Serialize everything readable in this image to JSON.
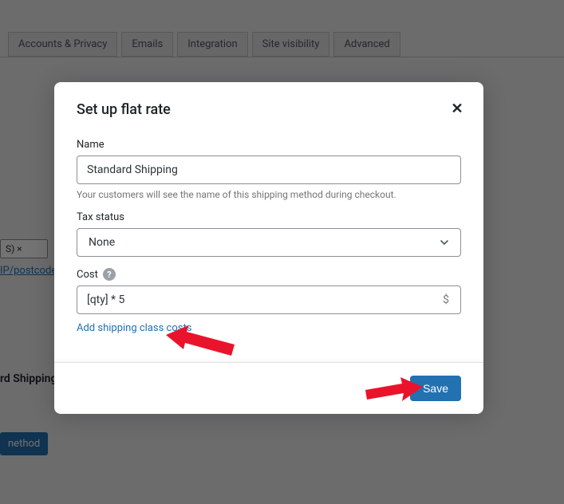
{
  "background": {
    "tabs": [
      "Accounts & Privacy",
      "Emails",
      "Integration",
      "Site visibility",
      "Advanced"
    ],
    "zone_tag": "S)  ×",
    "postcodes_link": "IP/postcodes",
    "shipping_row": "rd Shipping",
    "method_button": "nethod"
  },
  "modal": {
    "title": "Set up flat rate",
    "name": {
      "label": "Name",
      "value": "Standard Shipping",
      "help": "Your customers will see the name of this shipping method during checkout."
    },
    "tax_status": {
      "label": "Tax status",
      "value": "None"
    },
    "cost": {
      "label": "Cost",
      "value": "[qty] * 5",
      "currency": "$"
    },
    "add_class_link": "Add shipping class costs",
    "save_label": "Save"
  }
}
